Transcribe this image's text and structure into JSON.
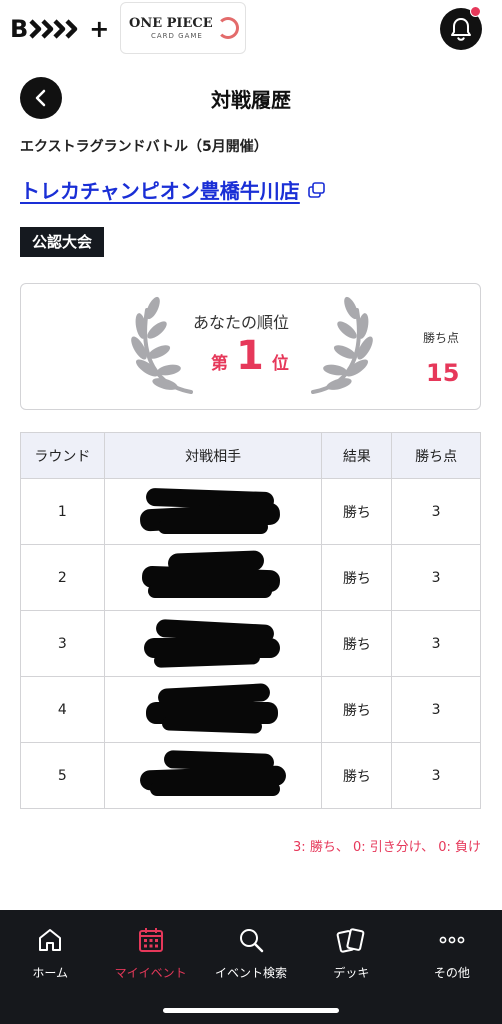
{
  "header": {
    "brand_logo": "B",
    "brand_logo_suffix": "+",
    "game_logo_line1": "ONE PIECE",
    "game_logo_line2": "CARD GAME",
    "page_title": "対戦履歴"
  },
  "event": {
    "name": "エクストラグランドバトル（5月開催）",
    "store": "トレカチャンピオン豊橋牛川店",
    "badge": "公認大会"
  },
  "rank": {
    "label": "あなたの順位",
    "prefix": "第",
    "value": "1",
    "suffix": "位",
    "points_label": "勝ち点",
    "points_value": "15"
  },
  "table": {
    "headers": [
      "ラウンド",
      "対戦相手",
      "結果",
      "勝ち点"
    ],
    "rows": [
      {
        "round": "1",
        "result": "勝ち",
        "points": "3"
      },
      {
        "round": "2",
        "result": "勝ち",
        "points": "3"
      },
      {
        "round": "3",
        "result": "勝ち",
        "points": "3"
      },
      {
        "round": "4",
        "result": "勝ち",
        "points": "3"
      },
      {
        "round": "5",
        "result": "勝ち",
        "points": "3"
      }
    ]
  },
  "legend": "3: 勝ち、 0: 引き分け、 0: 負け",
  "nav": {
    "items": [
      {
        "label": "ホーム",
        "icon": "home-icon"
      },
      {
        "label": "マイイベント",
        "icon": "calendar-icon"
      },
      {
        "label": "イベント検索",
        "icon": "search-icon"
      },
      {
        "label": "デッキ",
        "icon": "cards-icon"
      },
      {
        "label": "その他",
        "icon": "more-icon"
      }
    ],
    "active_index": 1
  },
  "colors": {
    "accent": "#e6385a",
    "link": "#1a2fd6",
    "nav_bg": "#16181c",
    "table_header_bg": "#eef0f8"
  }
}
